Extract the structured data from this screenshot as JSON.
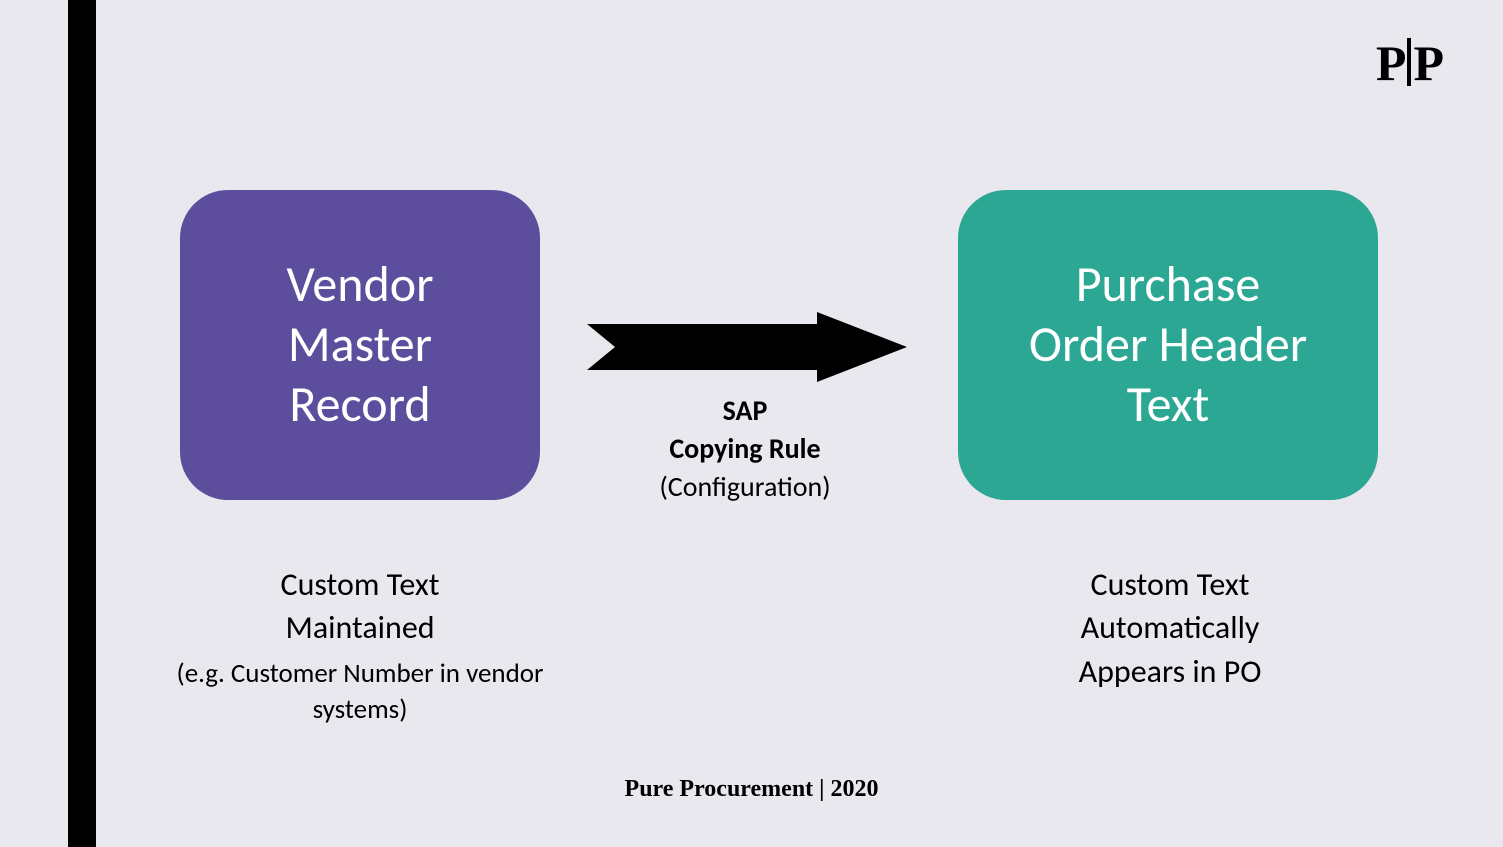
{
  "logo": {
    "left": "P",
    "right": "P"
  },
  "boxes": {
    "left": {
      "title": "Vendor\nMaster\nRecord",
      "caption_main": "Custom Text\nMaintained",
      "caption_sub": "(e.g. Customer Number in vendor\nsystems)",
      "color": "#5c4e9d"
    },
    "right": {
      "title": "Purchase\nOrder Header\nText",
      "caption_main": "Custom Text\nAutomatically\nAppears in PO",
      "color": "#2ba793"
    }
  },
  "arrow": {
    "line1": "SAP",
    "line2": "Copying Rule",
    "line3": "(Configuration)"
  },
  "footer": "Pure Procurement | 2020"
}
